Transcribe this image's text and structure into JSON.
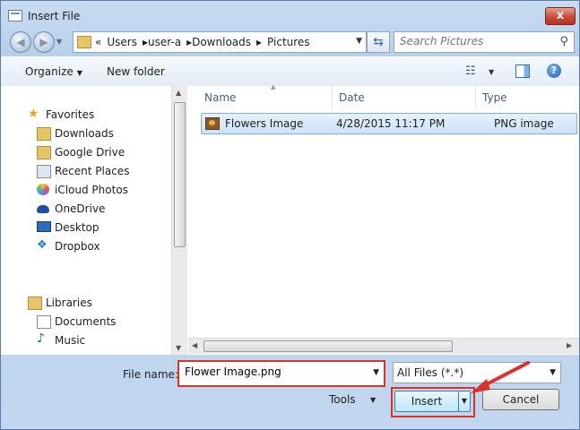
{
  "window": {
    "title": "Insert File",
    "close_glyph": "x"
  },
  "navbar": {
    "breadcrumb": [
      "«",
      "Users",
      "▸user-a",
      "▸Downloads",
      "▸",
      "Pictures"
    ],
    "search_placeholder": "Search Pictures"
  },
  "toolbar": {
    "organize_label": "Organize",
    "new_folder_label": "New folder",
    "help_glyph": "?"
  },
  "sidebar": {
    "favorites_label": "Favorites",
    "favorites": [
      {
        "label": "Downloads",
        "icon": "downloads-folder-icon"
      },
      {
        "label": "Google Drive",
        "icon": "google-drive-icon"
      },
      {
        "label": "Recent Places",
        "icon": "recent-places-icon"
      },
      {
        "label": "iCloud Photos",
        "icon": "icloud-photos-icon"
      },
      {
        "label": "OneDrive",
        "icon": "onedrive-icon"
      },
      {
        "label": "Desktop",
        "icon": "desktop-icon"
      },
      {
        "label": "Dropbox",
        "icon": "dropbox-icon"
      }
    ],
    "libraries_label": "Libraries",
    "libraries": [
      {
        "label": "Documents",
        "icon": "documents-icon"
      },
      {
        "label": "Music",
        "icon": "music-icon"
      }
    ]
  },
  "file_list": {
    "columns": [
      "Name",
      "Date",
      "Type"
    ],
    "rows": [
      {
        "name": "Flowers Image",
        "date": "4/28/2015 11:17 PM",
        "type": "PNG image",
        "icon": "png-image-icon"
      }
    ]
  },
  "bottom": {
    "file_name_label": "File name:",
    "file_name_value": "Flower Image.png",
    "file_type_value": "All Files (*.*)",
    "tools_label": "Tools",
    "insert_label": "Insert",
    "cancel_label": "Cancel"
  },
  "colors": {
    "highlight_red": "#d9322a",
    "selection_blue": "#cde3f8",
    "accent_blue": "#3c7fb1"
  }
}
